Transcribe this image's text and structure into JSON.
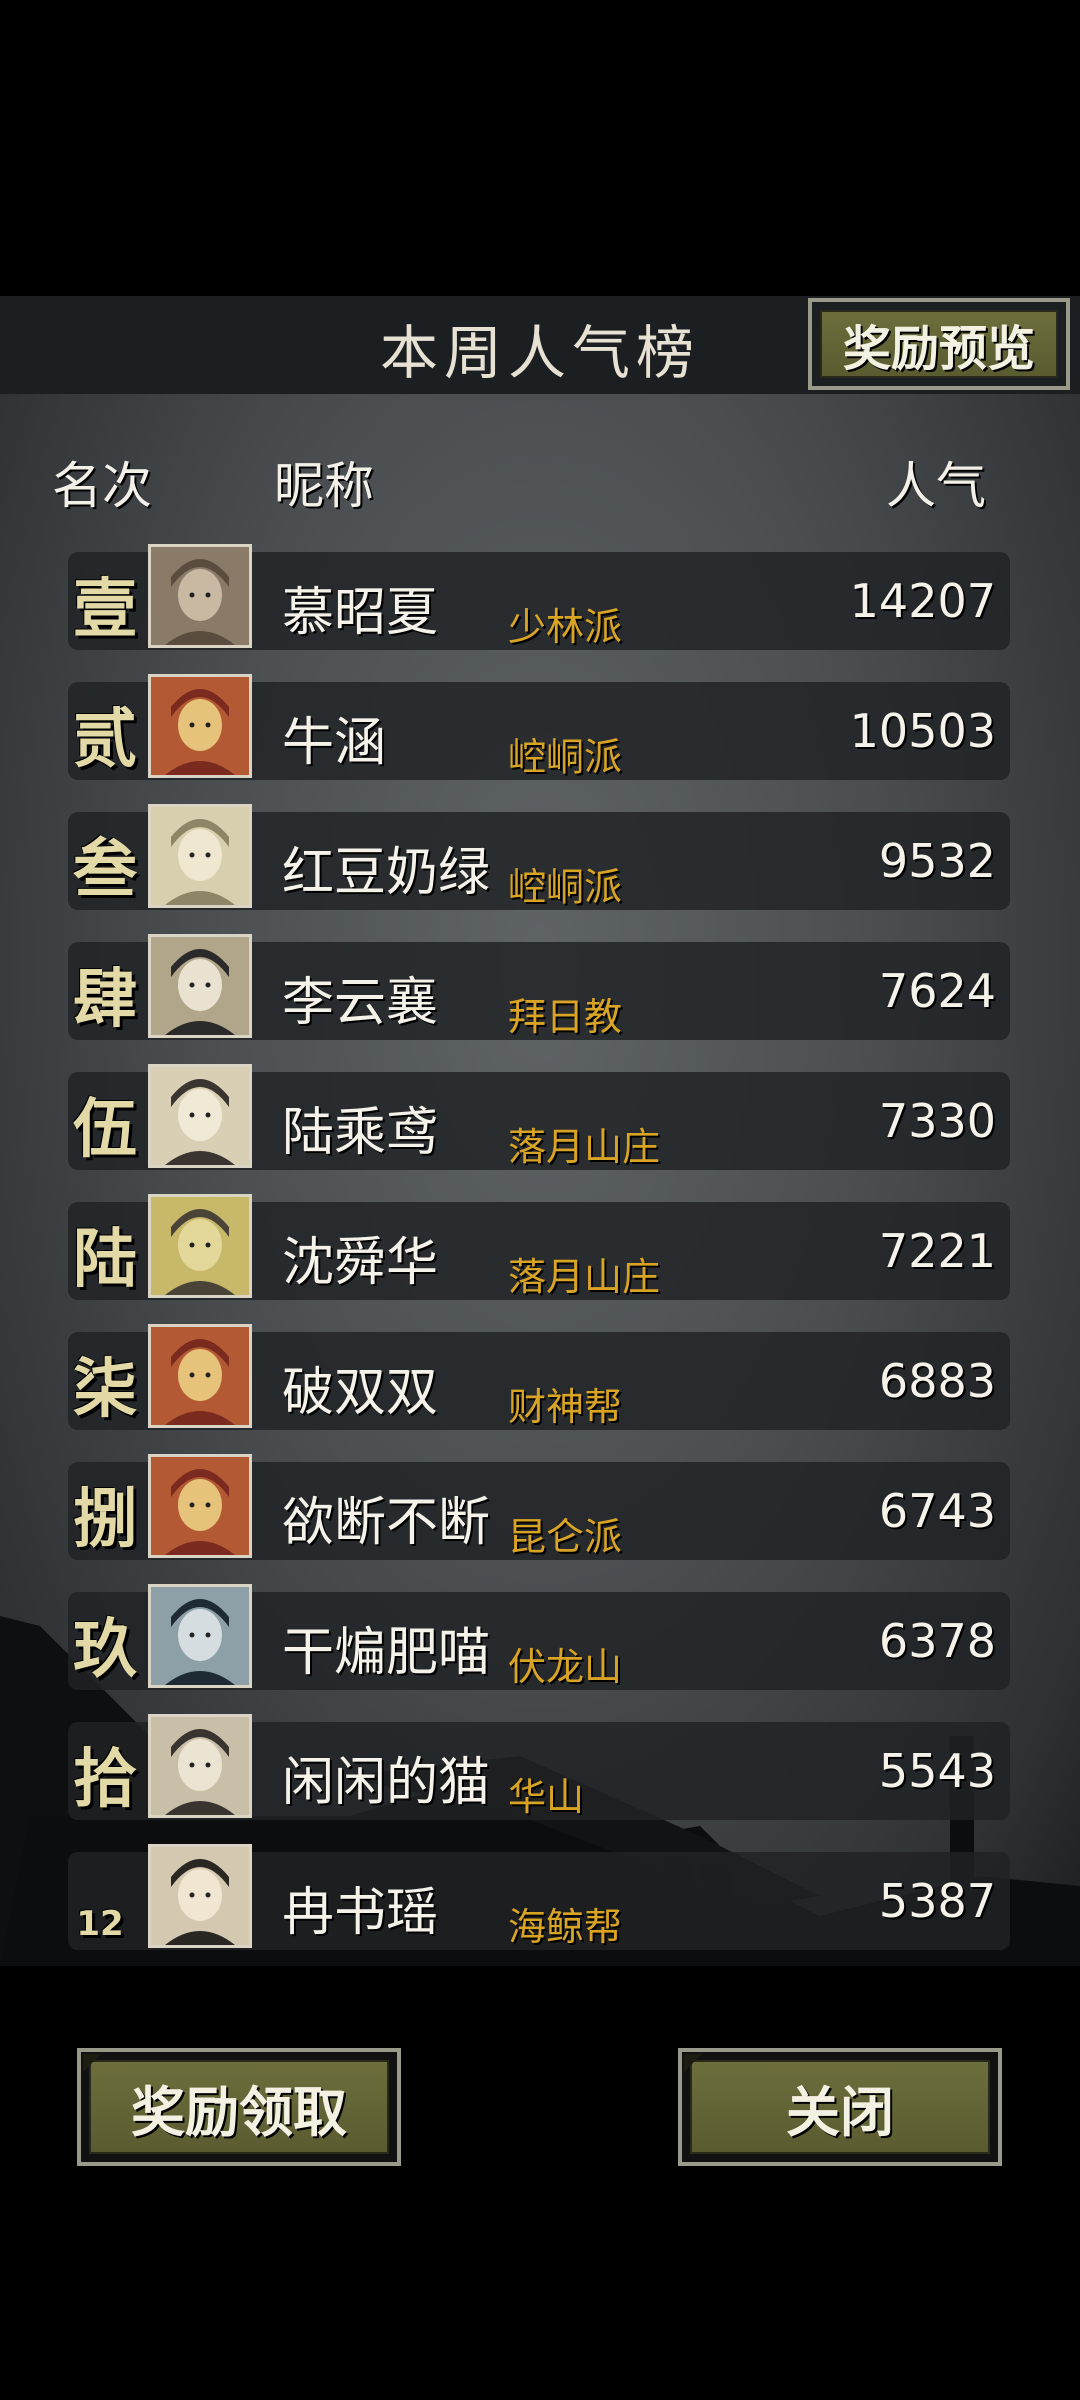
{
  "header": {
    "title": "本周人气榜",
    "preview_label": "奖励预览"
  },
  "columns": {
    "rank": "名次",
    "nickname": "昵称",
    "popularity": "人气"
  },
  "rows": [
    {
      "rank": "壹",
      "name": "慕昭夏",
      "sect": "少林派",
      "popularity": "14207"
    },
    {
      "rank": "贰",
      "name": "牛涵",
      "sect": "崆峒派",
      "popularity": "10503"
    },
    {
      "rank": "叁",
      "name": "红豆奶绿",
      "sect": "崆峒派",
      "popularity": "9532"
    },
    {
      "rank": "肆",
      "name": "李云襄",
      "sect": "拜日教",
      "popularity": "7624"
    },
    {
      "rank": "伍",
      "name": "陆乘鸢",
      "sect": "落月山庄",
      "popularity": "7330"
    },
    {
      "rank": "陆",
      "name": "沈舜华",
      "sect": "落月山庄",
      "popularity": "7221"
    },
    {
      "rank": "柒",
      "name": "破双双",
      "sect": "财神帮",
      "popularity": "6883"
    },
    {
      "rank": "捌",
      "name": "欲断不断",
      "sect": "昆仑派",
      "popularity": "6743"
    },
    {
      "rank": "玖",
      "name": "干煸肥喵",
      "sect": "伏龙山",
      "popularity": "6378"
    },
    {
      "rank": "拾",
      "name": "闲闲的猫",
      "sect": "华山",
      "popularity": "5543"
    },
    {
      "rank": "12",
      "name": "冉书瑶",
      "sect": "海鲸帮",
      "popularity": "5387"
    }
  ],
  "footer": {
    "claim_label": "奖励领取",
    "close_label": "关闭"
  },
  "colors": {
    "sect_text": "#d9a423",
    "rank_text": "#e3d9a6",
    "button_fill": "#6d6e3c"
  }
}
